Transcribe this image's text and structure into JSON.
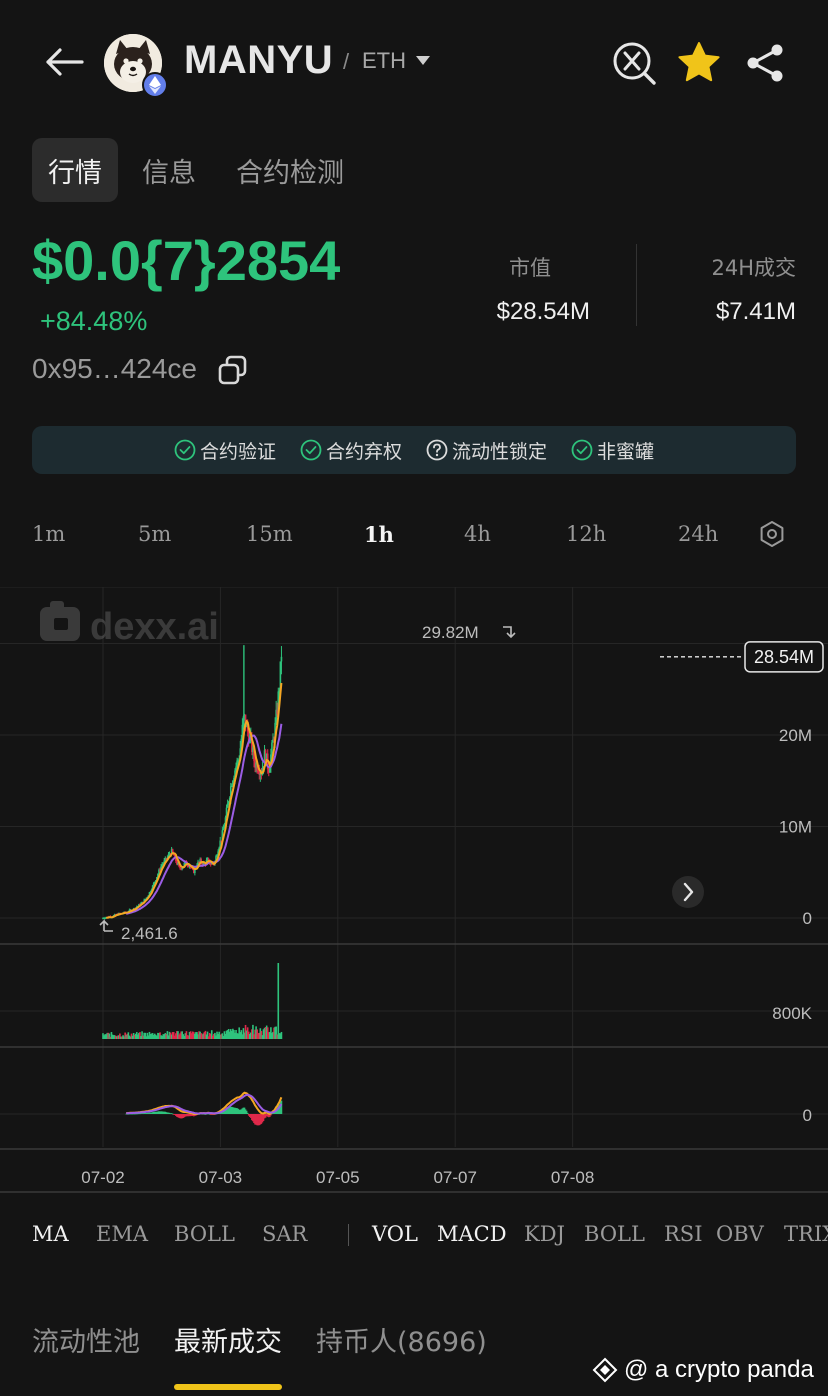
{
  "header": {
    "token_name": "MANYU",
    "separator": "/",
    "chain": "ETH",
    "icons": {
      "back": "arrow-left-icon",
      "x": "x-search-icon",
      "favorite": "star-icon",
      "share": "share-icon",
      "chain_badge": "ethereum-icon"
    }
  },
  "tabs": [
    "行情",
    "信息",
    "合约检测"
  ],
  "price": {
    "value": "$0.0{7}2854",
    "change": "+84.48%",
    "address": "0x95…424ce"
  },
  "stats": {
    "market_cap_label": "市值",
    "market_cap_value": "$28.54M",
    "volume_label": "24H成交",
    "volume_value": "$7.41M"
  },
  "safety": [
    {
      "label": "合约验证",
      "icon": "check-circle-icon"
    },
    {
      "label": "合约弃权",
      "icon": "check-circle-icon"
    },
    {
      "label": "流动性锁定",
      "icon": "question-circle-icon"
    },
    {
      "label": "非蜜罐",
      "icon": "check-circle-icon"
    }
  ],
  "intervals": [
    "1m",
    "5m",
    "15m",
    "1h",
    "4h",
    "12h",
    "24h"
  ],
  "active_interval": "1h",
  "chart_data": {
    "type": "candlestick",
    "watermark": "dexx.ai",
    "x_ticks": [
      "07-02",
      "07-03",
      "07-05",
      "07-07",
      "07-08"
    ],
    "y_ticks": [
      "0",
      "10M",
      "20M"
    ],
    "y_range": [
      0,
      30000000
    ],
    "high_label": "29.82M",
    "low_label": "2,461.6",
    "current_label": "28.54M",
    "volume_tick": "800K",
    "macd_tick": "0",
    "close_path": [
      [
        0.0,
        0.003
      ],
      [
        0.08,
        0.2
      ],
      [
        0.14,
        0.45
      ],
      [
        0.2,
        0.62
      ],
      [
        0.26,
        1.0
      ],
      [
        0.3,
        1.35
      ],
      [
        0.34,
        1.75
      ],
      [
        0.38,
        2.4
      ],
      [
        0.42,
        3.4
      ],
      [
        0.46,
        4.6
      ],
      [
        0.5,
        5.8
      ],
      [
        0.54,
        6.4
      ],
      [
        0.58,
        7.3
      ],
      [
        0.6,
        6.9
      ],
      [
        0.62,
        6.3
      ],
      [
        0.65,
        5.4
      ],
      [
        0.68,
        5.7
      ],
      [
        0.71,
        6.1
      ],
      [
        0.74,
        5.7
      ],
      [
        0.77,
        5.0
      ],
      [
        0.8,
        5.9
      ],
      [
        0.83,
        6.2
      ],
      [
        0.86,
        5.9
      ],
      [
        0.89,
        6.3
      ],
      [
        0.92,
        5.9
      ],
      [
        0.95,
        6.0
      ],
      [
        0.98,
        7.6
      ],
      [
        1.01,
        8.8
      ],
      [
        1.04,
        10.6
      ],
      [
        1.07,
        13.0
      ],
      [
        1.1,
        15.2
      ],
      [
        1.13,
        16.5
      ],
      [
        1.16,
        17.6
      ],
      [
        1.2,
        22.0
      ],
      [
        1.23,
        20.5
      ],
      [
        1.26,
        19.2
      ],
      [
        1.29,
        17.0
      ],
      [
        1.32,
        16.6
      ],
      [
        1.35,
        16.0
      ],
      [
        1.38,
        18.0
      ],
      [
        1.41,
        16.3
      ],
      [
        1.44,
        18.5
      ],
      [
        1.47,
        21.2
      ],
      [
        1.5,
        25.0
      ],
      [
        1.52,
        28.54
      ]
    ],
    "overlays": [
      "MA7",
      "MA25"
    ],
    "volume_spike_day_fraction": 1.49
  },
  "indicators": {
    "main": [
      "MA",
      "EMA",
      "BOLL",
      "SAR"
    ],
    "sub": [
      "VOL",
      "MACD",
      "KDJ",
      "BOLL",
      "RSI",
      "OBV",
      "TRIX"
    ],
    "active_sub": [
      "VOL",
      "MACD"
    ]
  },
  "bottom_tabs": [
    "流动性池",
    "最新成交",
    "持币人(8696)"
  ],
  "active_bottom_tab": "最新成交",
  "watermark_text": "@ a crypto panda",
  "colors": {
    "up": "#2ec37c",
    "down": "#e0294a",
    "ma_fast": "#f5a623",
    "ma_slow": "#9b5de5",
    "accent": "#f0c419",
    "safety_bg": "#1d2b30"
  }
}
